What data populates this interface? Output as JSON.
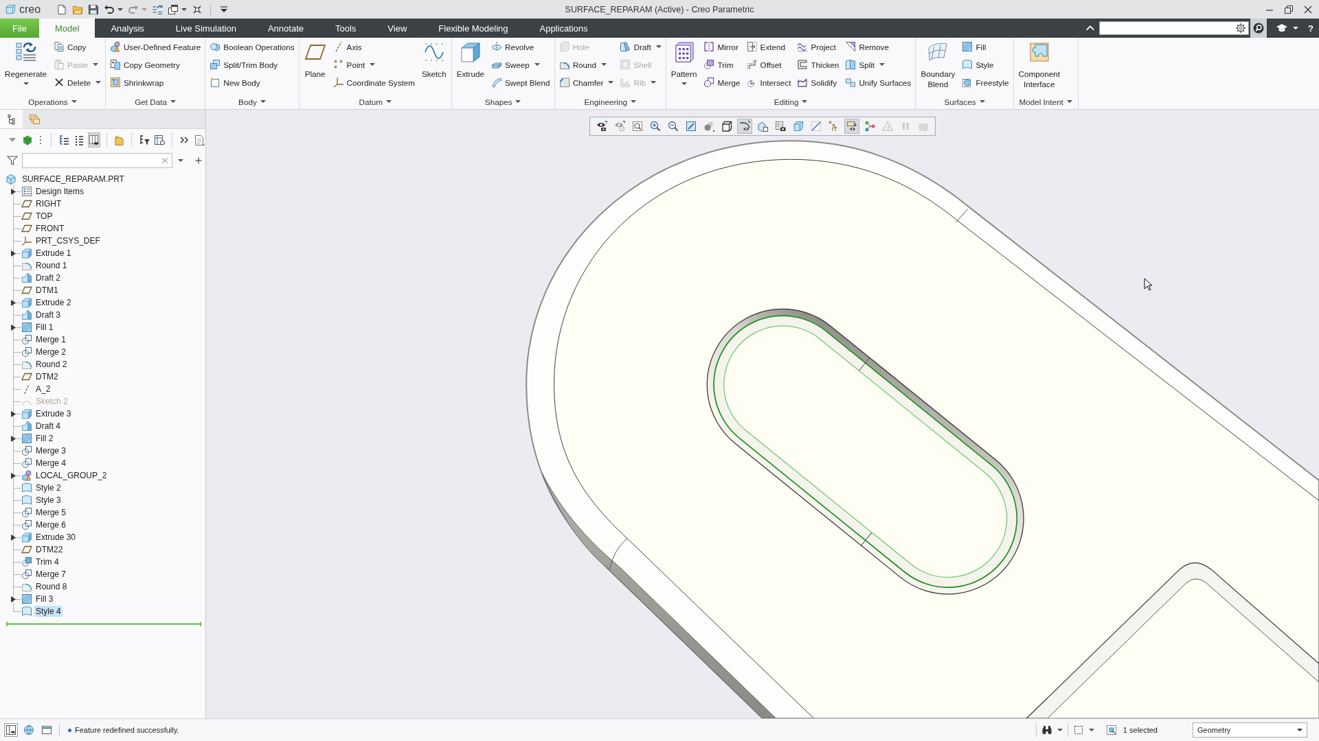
{
  "window": {
    "logo": "creo",
    "title": "SURFACE_REPARAM (Active) - Creo Parametric"
  },
  "quick_access": [
    {
      "disabled": false
    },
    {
      "disabled": false
    },
    {
      "disabled": false
    },
    {
      "disabled": false
    },
    {
      "disabled": true
    },
    {
      "disabled": false
    },
    {
      "disabled": false
    },
    {
      "disabled": false
    },
    {
      "disabled": false
    }
  ],
  "tabs": [
    {
      "label": "File",
      "kind": "file",
      "selected": false
    },
    {
      "label": "Model",
      "kind": "tab",
      "selected": true
    },
    {
      "label": "Analysis",
      "kind": "tab",
      "selected": false
    },
    {
      "label": "Live Simulation",
      "kind": "tab",
      "selected": false
    },
    {
      "label": "Annotate",
      "kind": "tab",
      "selected": false
    },
    {
      "label": "Tools",
      "kind": "tab",
      "selected": false
    },
    {
      "label": "View",
      "kind": "tab",
      "selected": false
    },
    {
      "label": "Flexible Modeling",
      "kind": "tab",
      "selected": false
    },
    {
      "label": "Applications",
      "kind": "tab",
      "selected": false
    }
  ],
  "help": {
    "label": "?"
  },
  "ribbon": {
    "groups": [
      {
        "label": "Operations",
        "dropdown": true,
        "columns": [
          {
            "kind": "large",
            "items": [
              {
                "label": "Regenerate",
                "dropdown": true,
                "disabled": false
              }
            ]
          },
          {
            "kind": "small",
            "items": [
              {
                "label": "Copy",
                "dropdown": false,
                "disabled": false
              },
              {
                "label": "Paste",
                "dropdown": true,
                "disabled": true
              },
              {
                "label": "Delete",
                "dropdown": true,
                "disabled": false
              }
            ]
          }
        ]
      },
      {
        "label": "Get Data",
        "dropdown": true,
        "columns": [
          {
            "kind": "small",
            "items": [
              {
                "label": "User-Defined Feature",
                "dropdown": false,
                "disabled": false
              },
              {
                "label": "Copy Geometry",
                "dropdown": false,
                "disabled": false
              },
              {
                "label": "Shrinkwrap",
                "dropdown": false,
                "disabled": false
              }
            ]
          }
        ]
      },
      {
        "label": "Body",
        "dropdown": true,
        "columns": [
          {
            "kind": "small",
            "items": [
              {
                "label": "Boolean Operations",
                "dropdown": false,
                "disabled": false
              },
              {
                "label": "Split/Trim Body",
                "dropdown": false,
                "disabled": false
              },
              {
                "label": "New Body",
                "dropdown": false,
                "disabled": false
              }
            ]
          }
        ]
      },
      {
        "label": "Datum",
        "dropdown": true,
        "columns": [
          {
            "kind": "large",
            "items": [
              {
                "label": "Plane",
                "dropdown": false,
                "disabled": false
              }
            ]
          },
          {
            "kind": "small",
            "items": [
              {
                "label": "Axis",
                "dropdown": false,
                "disabled": false
              },
              {
                "label": "Point",
                "dropdown": true,
                "disabled": false
              },
              {
                "label": "Coordinate System",
                "dropdown": false,
                "disabled": false
              }
            ]
          },
          {
            "kind": "large",
            "items": [
              {
                "label": "Sketch",
                "dropdown": false,
                "disabled": false
              }
            ]
          }
        ]
      },
      {
        "label": "Shapes",
        "dropdown": true,
        "columns": [
          {
            "kind": "large",
            "items": [
              {
                "label": "Extrude",
                "dropdown": false,
                "disabled": false
              }
            ]
          },
          {
            "kind": "small",
            "items": [
              {
                "label": "Revolve",
                "dropdown": false,
                "disabled": false
              },
              {
                "label": "Sweep",
                "dropdown": true,
                "disabled": false
              },
              {
                "label": "Swept Blend",
                "dropdown": false,
                "disabled": false
              }
            ]
          }
        ]
      },
      {
        "label": "Engineering",
        "dropdown": true,
        "columns": [
          {
            "kind": "small",
            "items": [
              {
                "label": "Hole",
                "dropdown": false,
                "disabled": true
              },
              {
                "label": "Round",
                "dropdown": true,
                "disabled": false
              },
              {
                "label": "Chamfer",
                "dropdown": true,
                "disabled": false
              }
            ]
          },
          {
            "kind": "small",
            "items": [
              {
                "label": "Draft",
                "dropdown": true,
                "disabled": false
              },
              {
                "label": "Shell",
                "dropdown": false,
                "disabled": true
              },
              {
                "label": "Rib",
                "dropdown": true,
                "disabled": true
              }
            ]
          }
        ]
      },
      {
        "label": "Editing",
        "dropdown": true,
        "columns": [
          {
            "kind": "large",
            "items": [
              {
                "label": "Pattern",
                "dropdown": true,
                "disabled": false
              }
            ]
          },
          {
            "kind": "small",
            "items": [
              {
                "label": "Mirror",
                "dropdown": false,
                "disabled": false
              },
              {
                "label": "Trim",
                "dropdown": false,
                "disabled": false
              },
              {
                "label": "Merge",
                "dropdown": false,
                "disabled": false
              }
            ]
          },
          {
            "kind": "small",
            "items": [
              {
                "label": "Extend",
                "dropdown": false,
                "disabled": false
              },
              {
                "label": "Offset",
                "dropdown": false,
                "disabled": false
              },
              {
                "label": "Intersect",
                "dropdown": false,
                "disabled": false
              }
            ]
          },
          {
            "kind": "small",
            "items": [
              {
                "label": "Project",
                "dropdown": false,
                "disabled": false
              },
              {
                "label": "Thicken",
                "dropdown": false,
                "disabled": false
              },
              {
                "label": "Solidify",
                "dropdown": false,
                "disabled": false
              }
            ]
          },
          {
            "kind": "small",
            "items": [
              {
                "label": "Remove",
                "dropdown": false,
                "disabled": false
              },
              {
                "label": "Split",
                "dropdown": true,
                "disabled": false
              },
              {
                "label": "Unify Surfaces",
                "dropdown": false,
                "disabled": false
              }
            ]
          }
        ]
      },
      {
        "label": "Surfaces",
        "dropdown": true,
        "columns": [
          {
            "kind": "large",
            "items": [
              {
                "label": "Boundary Blend",
                "dropdown": false,
                "disabled": false
              }
            ]
          },
          {
            "kind": "small",
            "items": [
              {
                "label": "Fill",
                "dropdown": false,
                "disabled": false
              },
              {
                "label": "Style",
                "dropdown": false,
                "disabled": false
              },
              {
                "label": "Freestyle",
                "dropdown": false,
                "disabled": false
              }
            ]
          }
        ]
      },
      {
        "label": "Model Intent",
        "dropdown": true,
        "columns": [
          {
            "kind": "large",
            "items": [
              {
                "label": "Component Interface",
                "dropdown": false,
                "disabled": false
              }
            ]
          }
        ]
      }
    ]
  },
  "model_tree": {
    "tabs": [
      {
        "selected": true
      },
      {
        "selected": false
      }
    ],
    "toolbar": [
      {
        "on": false
      },
      {
        "on": false
      },
      {
        "on": false
      },
      {
        "on": false
      },
      {
        "on": false
      },
      {
        "on": true
      },
      {
        "on": false
      },
      {
        "on": false
      },
      {
        "on": false
      },
      {
        "on": false
      },
      {
        "on": false
      }
    ],
    "root": "SURFACE_REPARAM.PRT",
    "items": [
      {
        "label": "Design Items",
        "kind": "design-items",
        "has_children": true,
        "disabled": false,
        "selected": false
      },
      {
        "label": "RIGHT",
        "kind": "plane",
        "has_children": false,
        "disabled": false,
        "selected": false
      },
      {
        "label": "TOP",
        "kind": "plane",
        "has_children": false,
        "disabled": false,
        "selected": false
      },
      {
        "label": "FRONT",
        "kind": "plane",
        "has_children": false,
        "disabled": false,
        "selected": false
      },
      {
        "label": "PRT_CSYS_DEF",
        "kind": "csys",
        "has_children": false,
        "disabled": false,
        "selected": false
      },
      {
        "label": "Extrude 1",
        "kind": "extrude",
        "has_children": true,
        "disabled": false,
        "selected": false
      },
      {
        "label": "Round 1",
        "kind": "round",
        "has_children": false,
        "disabled": false,
        "selected": false
      },
      {
        "label": "Draft 2",
        "kind": "draft",
        "has_children": false,
        "disabled": false,
        "selected": false
      },
      {
        "label": "DTM1",
        "kind": "plane",
        "has_children": false,
        "disabled": false,
        "selected": false
      },
      {
        "label": "Extrude 2",
        "kind": "extrude",
        "has_children": true,
        "disabled": false,
        "selected": false
      },
      {
        "label": "Draft 3",
        "kind": "draft",
        "has_children": false,
        "disabled": false,
        "selected": false
      },
      {
        "label": "Fill 1",
        "kind": "fill",
        "has_children": true,
        "disabled": false,
        "selected": false
      },
      {
        "label": "Merge 1",
        "kind": "merge",
        "has_children": false,
        "disabled": false,
        "selected": false
      },
      {
        "label": "Merge 2",
        "kind": "merge",
        "has_children": false,
        "disabled": false,
        "selected": false
      },
      {
        "label": "Round 2",
        "kind": "round",
        "has_children": false,
        "disabled": false,
        "selected": false
      },
      {
        "label": "DTM2",
        "kind": "plane",
        "has_children": false,
        "disabled": false,
        "selected": false
      },
      {
        "label": "A_2",
        "kind": "axis",
        "has_children": false,
        "disabled": false,
        "selected": false
      },
      {
        "label": "Sketch 2",
        "kind": "sketch",
        "has_children": false,
        "disabled": true,
        "selected": false
      },
      {
        "label": "Extrude 3",
        "kind": "extrude",
        "has_children": true,
        "disabled": false,
        "selected": false
      },
      {
        "label": "Draft 4",
        "kind": "draft",
        "has_children": false,
        "disabled": false,
        "selected": false
      },
      {
        "label": "Fill 2",
        "kind": "fill",
        "has_children": true,
        "disabled": false,
        "selected": false
      },
      {
        "label": "Merge 3",
        "kind": "merge",
        "has_children": false,
        "disabled": false,
        "selected": false
      },
      {
        "label": "Merge 4",
        "kind": "merge",
        "has_children": false,
        "disabled": false,
        "selected": false
      },
      {
        "label": "LOCAL_GROUP_2",
        "kind": "group",
        "has_children": true,
        "disabled": false,
        "selected": false
      },
      {
        "label": "Style 2",
        "kind": "style",
        "has_children": false,
        "disabled": false,
        "selected": false
      },
      {
        "label": "Style 3",
        "kind": "style",
        "has_children": false,
        "disabled": false,
        "selected": false
      },
      {
        "label": "Merge 5",
        "kind": "merge",
        "has_children": false,
        "disabled": false,
        "selected": false
      },
      {
        "label": "Merge 6",
        "kind": "merge",
        "has_children": false,
        "disabled": false,
        "selected": false
      },
      {
        "label": "Extrude 30",
        "kind": "extrude",
        "has_children": true,
        "disabled": false,
        "selected": false
      },
      {
        "label": "DTM22",
        "kind": "plane",
        "has_children": false,
        "disabled": false,
        "selected": false
      },
      {
        "label": "Trim 4",
        "kind": "trim",
        "has_children": false,
        "disabled": false,
        "selected": false
      },
      {
        "label": "Merge 7",
        "kind": "merge",
        "has_children": false,
        "disabled": false,
        "selected": false
      },
      {
        "label": "Round 8",
        "kind": "round",
        "has_children": false,
        "disabled": false,
        "selected": false
      },
      {
        "label": "Fill 3",
        "kind": "fill",
        "has_children": true,
        "disabled": false,
        "selected": false
      },
      {
        "label": "Style 4",
        "kind": "style",
        "has_children": false,
        "disabled": false,
        "selected": true
      }
    ]
  },
  "view_toolbar": [
    {
      "on": false,
      "disabled": false
    },
    {
      "on": false,
      "disabled": false
    },
    {
      "on": false,
      "disabled": false
    },
    {
      "on": false,
      "disabled": false
    },
    {
      "on": false,
      "disabled": false
    },
    {
      "on": false,
      "disabled": false
    },
    {
      "on": false,
      "disabled": false
    },
    {
      "on": false,
      "disabled": false
    },
    {
      "on": true,
      "disabled": false
    },
    {
      "on": false,
      "disabled": false
    },
    {
      "on": false,
      "disabled": false
    },
    {
      "on": false,
      "disabled": false
    },
    {
      "on": false,
      "disabled": false
    },
    {
      "on": false,
      "disabled": false
    },
    {
      "on": true,
      "disabled": false
    },
    {
      "on": false,
      "disabled": false
    },
    {
      "on": false,
      "disabled": true
    },
    {
      "on": false,
      "disabled": true
    },
    {
      "on": false,
      "disabled": true
    }
  ],
  "status_bar": {
    "message": "Feature redefined successfully.",
    "selection": "1 selected",
    "filter": "Geometry"
  }
}
